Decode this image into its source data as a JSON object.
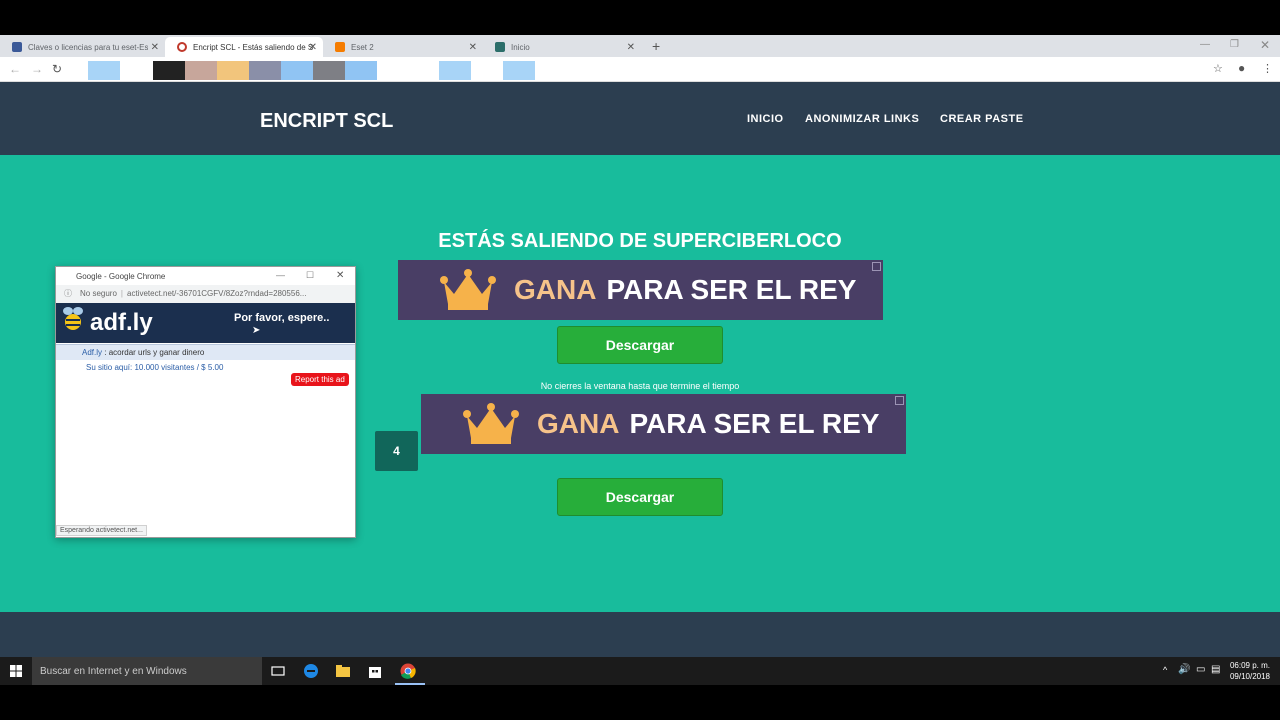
{
  "browser": {
    "tabs": [
      {
        "title": "Claves o licencias para tu eset-Es",
        "favicon_color": "#3b5998"
      },
      {
        "title": "Encript SCL - Estás saliendo de S",
        "favicon_color": "#c0392b"
      },
      {
        "title": "Eset 2",
        "favicon_color": "#f57c00"
      },
      {
        "title": "Inicio",
        "favicon_color": "#2c6e6a"
      }
    ],
    "bookmark_colors": [
      "#a8d4f7",
      "#222",
      "#c7a69b",
      "#f2c57c",
      "#8a8fa8",
      "#90c4f3",
      "#7e7f85",
      "#90c4f3",
      "#a8d4f7",
      "#a8d4f7"
    ]
  },
  "site": {
    "brand": "ENCRIPT SCL",
    "nav": [
      "INICIO",
      "ANONIMIZAR LINKS",
      "CREAR PASTE"
    ],
    "heading": "ESTÁS SALIENDO DE SUPERCIBERLOCO",
    "ad_gana": "GANA",
    "ad_rest": "PARA SER EL REY",
    "download_label": "Descargar",
    "notice": "No cierres la ventana hasta que termine el tiempo",
    "counter": "4"
  },
  "popup": {
    "title": "Google - Google Chrome",
    "insecure": "No seguro",
    "url": "activetect.net/-36701CGFV/8Zoz?rndad=280556...",
    "logo": "adf.ly",
    "wait": "Por favor, espere..",
    "line_link": "Adf.ly",
    "line_text": ": acordar urls y ganar dinero",
    "sub": "Su sitio aquí: 10.000 visitantes / $ 5.00",
    "report": "Report this ad",
    "status": "Esperando activetect.net..."
  },
  "taskbar": {
    "search_placeholder": "Buscar en Internet y en Windows",
    "time": "06:09 p. m.",
    "date": "09/10/2018"
  },
  "colors": {
    "page_bg": "#18bc9c",
    "navbar": "#2c3e50",
    "ad_bg": "#493e65",
    "ad_accent": "#f6c38a",
    "button_green": "#27ae3a"
  }
}
